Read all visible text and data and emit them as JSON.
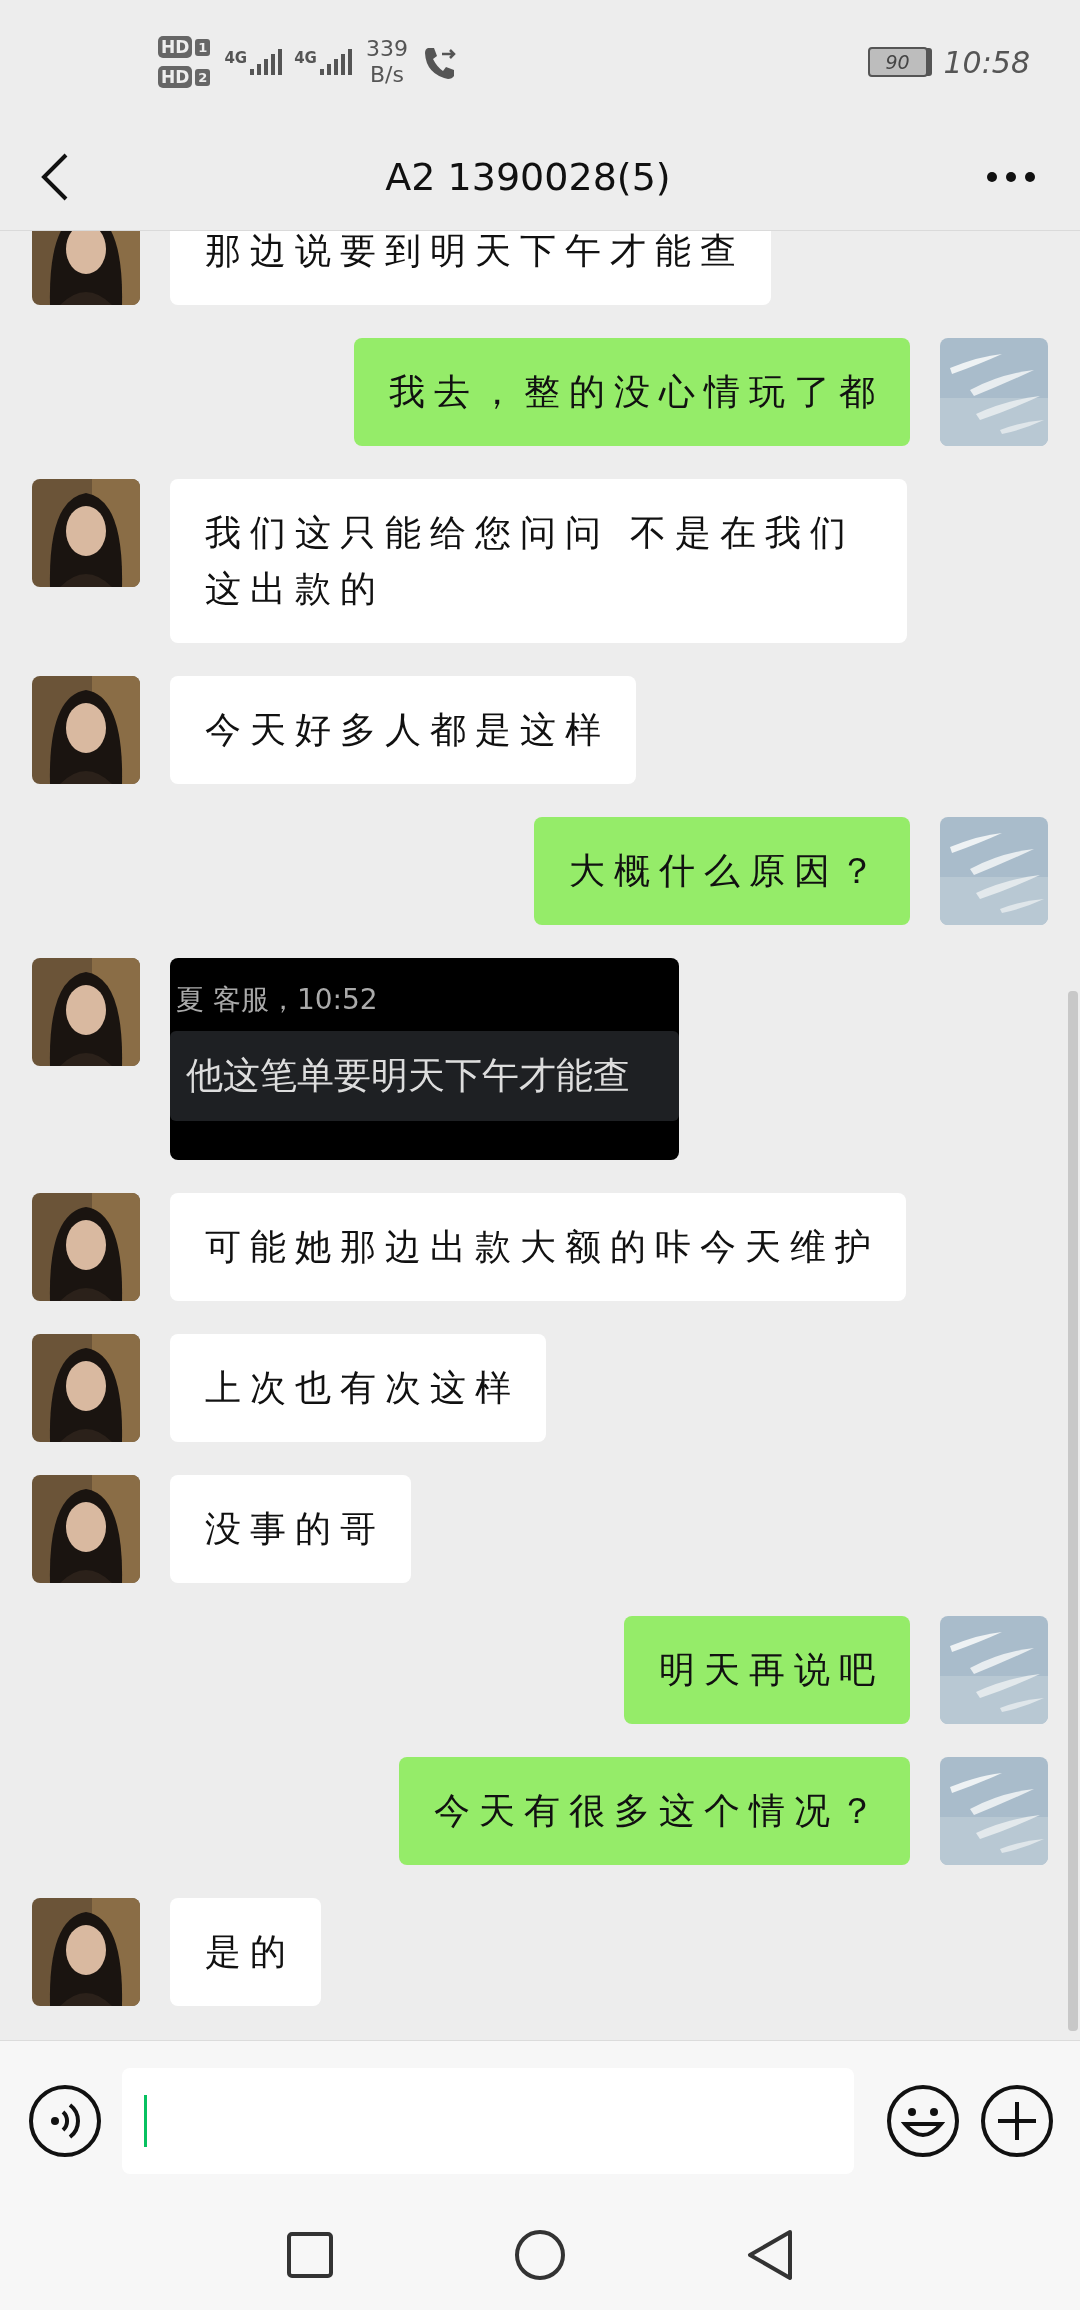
{
  "status_bar": {
    "sims": [
      {
        "badge": "HD",
        "slot": "1",
        "network": "4G"
      },
      {
        "badge": "HD",
        "slot": "2",
        "network": "4G"
      }
    ],
    "speed_value": "339",
    "speed_unit": "B/s",
    "battery": "90",
    "time": "10:58"
  },
  "header": {
    "title": "A2 1390028(5)"
  },
  "messages": [
    {
      "outgoing": false,
      "kind": "text",
      "text": "那边说要到明天下午才能查"
    },
    {
      "outgoing": true,
      "kind": "text",
      "text": "我去，整的没心情玩了都"
    },
    {
      "outgoing": false,
      "kind": "text",
      "text": "我们这只能给您问问 不是在我们这出款的"
    },
    {
      "outgoing": false,
      "kind": "text",
      "text": "今天好多人都是这样"
    },
    {
      "outgoing": true,
      "kind": "text",
      "text": "大概什么原因？"
    },
    {
      "outgoing": false,
      "header": "夏 客服，10:52",
      "text": "他这笔单要明天下午才能查"
    },
    {
      "outgoing": false,
      "kind": "text",
      "text": "可能她那边出款大额的咔今天维护"
    },
    {
      "outgoing": false,
      "kind": "text",
      "text": "上次也有次这样"
    },
    {
      "outgoing": false,
      "kind": "text",
      "text": "没事的哥"
    },
    {
      "outgoing": true,
      "kind": "text",
      "text": "明天再说吧"
    },
    {
      "outgoing": true,
      "kind": "text",
      "text": "今天有很多这个情况？"
    },
    {
      "outgoing": false,
      "kind": "text",
      "text": "是的"
    }
  ]
}
